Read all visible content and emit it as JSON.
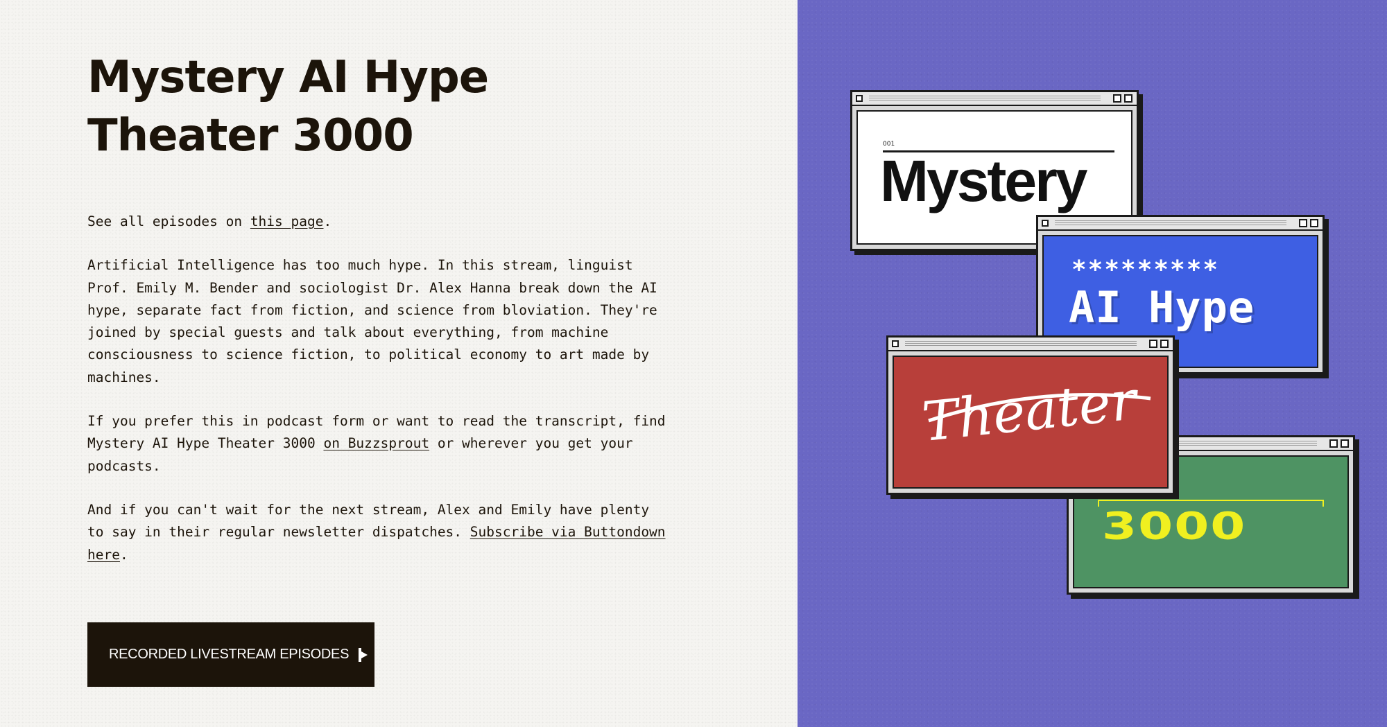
{
  "page": {
    "title": "Mystery AI Hype Theater 3000"
  },
  "intro": {
    "prefix": "See all episodes on ",
    "link": "this page",
    "suffix": "."
  },
  "about": {
    "text": "Artificial Intelligence has too much hype. In this stream, linguist Prof. Emily M. Bender and sociologist Dr. Alex Hanna break down the AI hype, separate fact from fiction, and science from bloviation. They're joined by special guests and talk about everything, from machine consciousness to science fiction, to political economy to art made by machines."
  },
  "podcast": {
    "prefix": "If you prefer this in podcast form or want to read the transcript, find Mystery AI Hype Theater 3000 ",
    "link": "on Buzzsprout",
    "suffix": " or wherever you get your podcasts."
  },
  "newsletter": {
    "prefix": "And if you can't wait for the next stream, Alex and Emily have plenty to say in their regular newsletter dispatches. ",
    "link": "Subscribe via Buttondown here",
    "suffix": "."
  },
  "cta": {
    "label": "RECORDED LIVESTREAM EPISODES",
    "icon": "arrow-right-icon"
  },
  "artwork": {
    "window1": {
      "number": "001",
      "word": "Mystery"
    },
    "window2": {
      "stars": "*********",
      "word": "AI Hype"
    },
    "window3": {
      "word": "Theater"
    },
    "window4": {
      "word": "3000"
    }
  },
  "colors": {
    "text": "#1c140a",
    "button_bg": "#1c140a",
    "panel_bg": "#6a67c4",
    "blue_window": "#3e5fe3",
    "red_window": "#b83f3a",
    "green_window": "#4e9363",
    "yellow_text": "#f0f020"
  }
}
